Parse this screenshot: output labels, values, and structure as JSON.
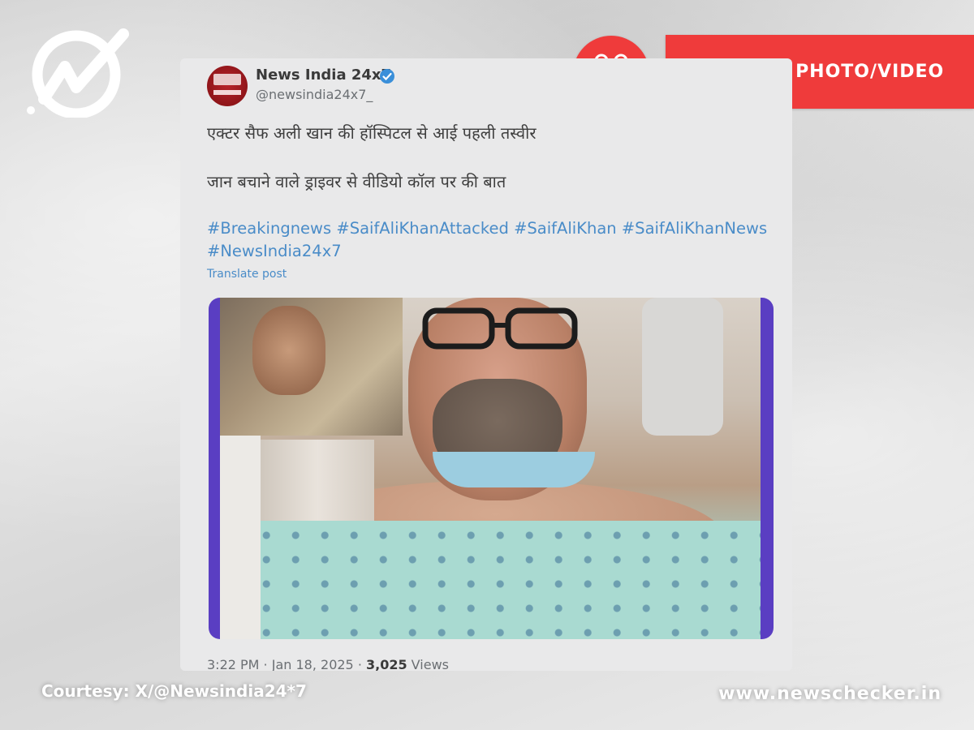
{
  "brand": {
    "logo_icon": "newschecker-logo-icon",
    "site_url": "www.newschecker.in"
  },
  "label": {
    "icon": "scissors-icon",
    "text": "ALTERED PHOTO/VIDEO",
    "color": "#ef3b3b"
  },
  "post": {
    "account_name": "News India 24x7",
    "handle": "@newsindia24x7_",
    "line1": "एक्टर सैफ अली खान की हॉस्पिटल से आई पहली तस्वीर",
    "line2": "जान बचाने वाले ड्राइवर से वीडियो कॉल पर की बात",
    "hashtags": "#Breakingnews #SaifAliKhanAttacked #SaifAliKhan #SaifAliKhanNews #NewsIndia24x7",
    "translate_label": "Translate post",
    "time": "3:22 PM · Jan 18, 2025 · ",
    "views_count": "3,025",
    "views_label": " Views"
  },
  "courtesy": "Courtesy: X/@Newsindia24*7"
}
